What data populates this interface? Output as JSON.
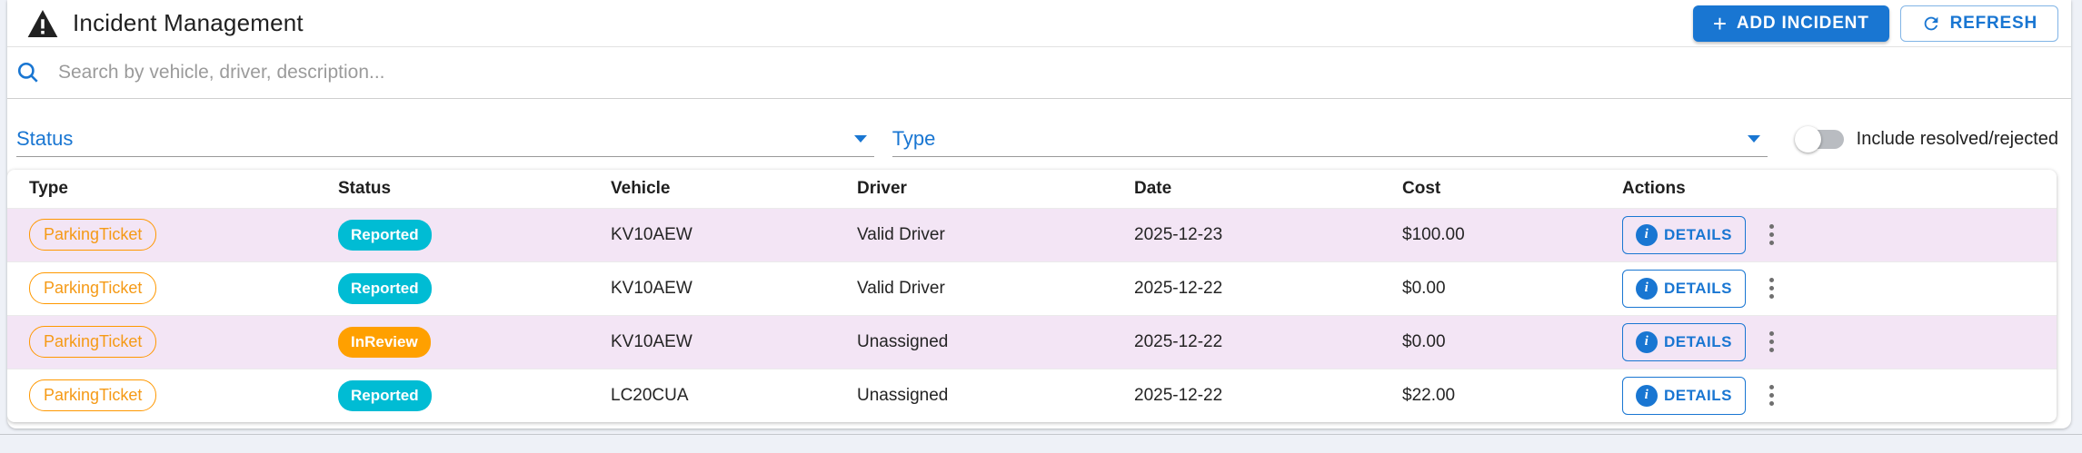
{
  "page": {
    "title": "Incident Management",
    "add_incident_label": "ADD INCIDENT",
    "refresh_label": "REFRESH"
  },
  "search": {
    "placeholder": "Search by vehicle, driver, description..."
  },
  "filters": {
    "status_label": "Status",
    "type_label": "Type",
    "toggle_label": "Include resolved/rejected",
    "toggle_state": "off"
  },
  "table": {
    "columns": [
      "Type",
      "Status",
      "Vehicle",
      "Driver",
      "Date",
      "Cost",
      "Actions"
    ],
    "details_label": "DETAILS",
    "rows": [
      {
        "type": "ParkingTicket",
        "status": "Reported",
        "vehicle": "KV10AEW",
        "driver": "Valid Driver",
        "date": "2025-12-23",
        "cost": "$100.00"
      },
      {
        "type": "ParkingTicket",
        "status": "Reported",
        "vehicle": "KV10AEW",
        "driver": "Valid Driver",
        "date": "2025-12-22",
        "cost": "$0.00"
      },
      {
        "type": "ParkingTicket",
        "status": "InReview",
        "vehicle": "KV10AEW",
        "driver": "Unassigned",
        "date": "2025-12-22",
        "cost": "$0.00"
      },
      {
        "type": "ParkingTicket",
        "status": "Reported",
        "vehicle": "LC20CUA",
        "driver": "Unassigned",
        "date": "2025-12-22",
        "cost": "$22.00"
      }
    ]
  },
  "colors": {
    "primary": "#1976d2",
    "reported_badge": "#00bcd4",
    "inreview_badge": "#ffa000",
    "type_chip_outline": "#ff9800",
    "row_stripe": "#f3e5f5",
    "page_background": "#eef1f7"
  }
}
